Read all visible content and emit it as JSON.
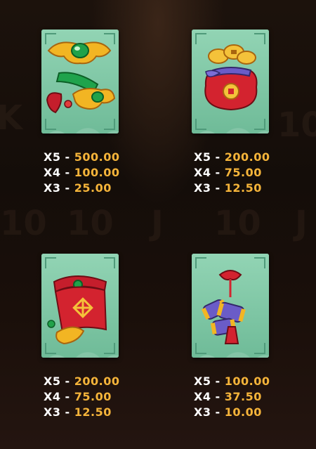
{
  "symbols": [
    {
      "name": "gold ingot with jade",
      "icon": "gold-ingot-icon",
      "payouts": [
        {
          "mult": "X5",
          "value": "500.00"
        },
        {
          "mult": "X4",
          "value": "100.00"
        },
        {
          "mult": "X3",
          "value": "25.00"
        }
      ]
    },
    {
      "name": "money pouch",
      "icon": "money-pouch-icon",
      "payouts": [
        {
          "mult": "X5",
          "value": "200.00"
        },
        {
          "mult": "X4",
          "value": "75.00"
        },
        {
          "mult": "X3",
          "value": "12.50"
        }
      ]
    },
    {
      "name": "red scroll",
      "icon": "red-scroll-icon",
      "payouts": [
        {
          "mult": "X5",
          "value": "200.00"
        },
        {
          "mult": "X4",
          "value": "75.00"
        },
        {
          "mult": "X3",
          "value": "12.50"
        }
      ]
    },
    {
      "name": "firecrackers",
      "icon": "firecracker-icon",
      "payouts": [
        {
          "mult": "X5",
          "value": "100.00"
        },
        {
          "mult": "X4",
          "value": "37.50"
        },
        {
          "mult": "X3",
          "value": "10.00"
        }
      ]
    }
  ],
  "separator": "-",
  "colors": {
    "multiplier": "#ffffff",
    "value": "#f5b43a",
    "card": "#7fc7a6",
    "background": "#120b08"
  }
}
